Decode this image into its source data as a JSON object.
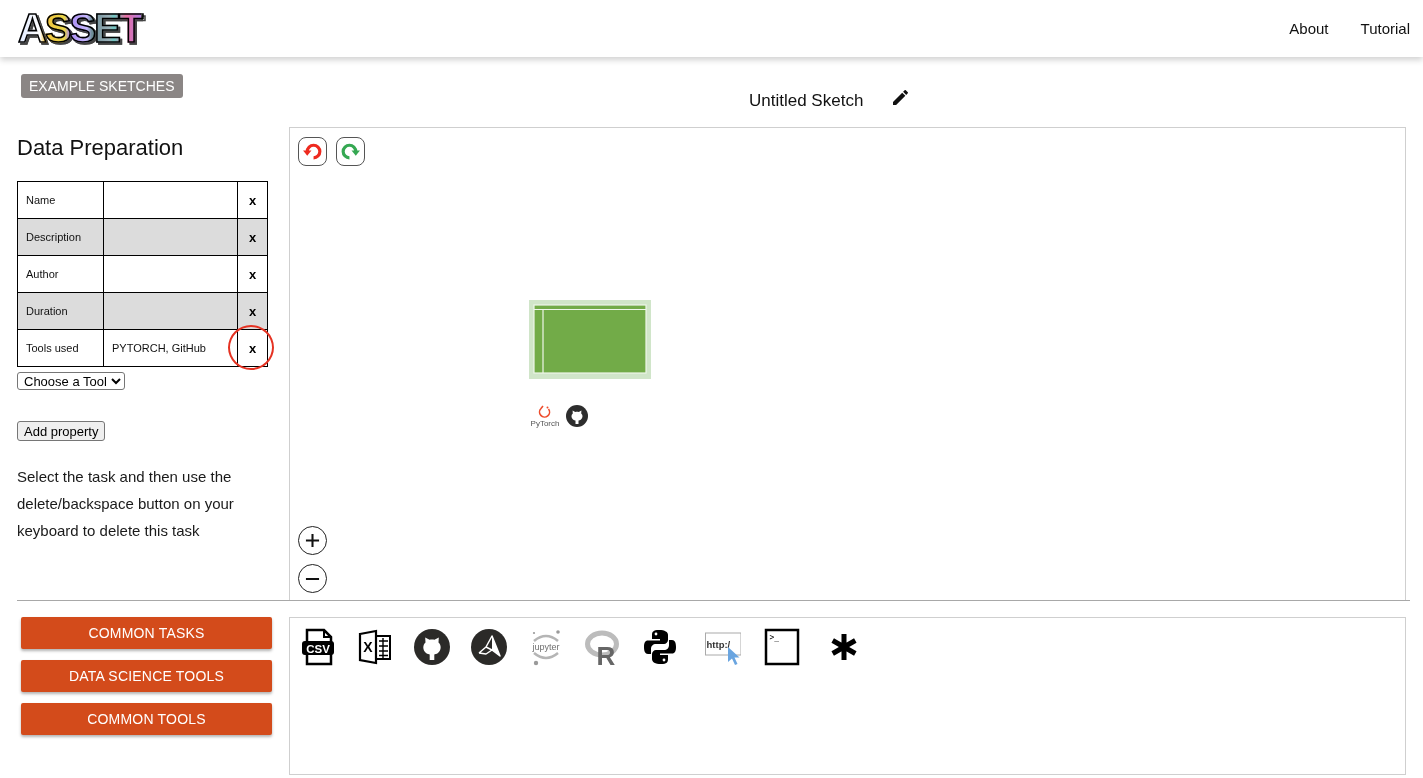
{
  "header": {
    "logo": "ASSET",
    "nav": [
      "About",
      "Tutorial"
    ]
  },
  "example_sketches_button": "EXAMPLE SKETCHES",
  "sketch": {
    "title": "Untitled Sketch"
  },
  "task_panel": {
    "title": "Data Preparation",
    "properties": [
      {
        "label": "Name",
        "delete": "x",
        "circled": false
      },
      {
        "label": "Description",
        "delete": "x",
        "circled": false
      },
      {
        "label": "Author",
        "delete": "x",
        "circled": false
      },
      {
        "label": "Duration",
        "delete": "x",
        "circled": false
      },
      {
        "label": "Tools used",
        "value": "PYTORCH, GitHub",
        "delete": "x",
        "circled": true
      }
    ],
    "tool_select": "Choose a Tool",
    "add_button": "Add property",
    "hint": "Select the task and then use the delete/backspace button on your keyboard to delete this task"
  },
  "canvas": {
    "nodes": [
      {
        "selected": true,
        "tools": [
          {
            "kind": "pytorch",
            "label": "PyTorch"
          },
          {
            "kind": "octocat"
          }
        ]
      }
    ]
  },
  "palette_buttons": [
    "COMMON TASKS",
    "DATA SCIENCE TOOLS",
    "COMMON TOOLS"
  ],
  "toolbox": [
    {
      "kind": "csv",
      "glyph": "CSV"
    },
    {
      "kind": "spreadsheet",
      "glyph": "X"
    },
    {
      "kind": "octocat"
    },
    {
      "kind": "peak"
    },
    {
      "kind": "jupyter",
      "glyph": "jupyter"
    },
    {
      "kind": "rlang",
      "glyph": "R"
    },
    {
      "kind": "python"
    },
    {
      "kind": "web",
      "glyph": "http:/"
    },
    {
      "kind": "terminal",
      "glyph": ">_"
    },
    {
      "kind": "asterisk"
    }
  ]
}
